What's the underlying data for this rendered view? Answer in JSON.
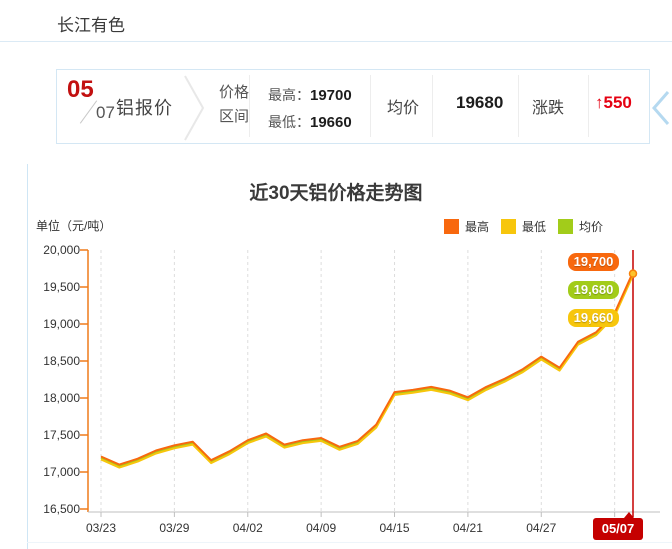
{
  "header": {
    "title": "长江有色"
  },
  "price_bar": {
    "date_top": "05",
    "date_bottom": "07",
    "product": "铝报价",
    "range_label_line1": "价格",
    "range_label_line2": "区间",
    "high_label": "最高：",
    "high_value": "19700",
    "low_label": "最低：",
    "low_value": "19660",
    "avg_label": "均价",
    "avg_value": "19680",
    "change_label": "涨跌",
    "change_arrow": "↑",
    "change_value": "550"
  },
  "icons": {
    "box_chevron": "breadcrumb-arrow",
    "right_chevron": "carousel-prev-arrow"
  },
  "colors": {
    "high": "#f8680e",
    "low": "#f7c60c",
    "avg": "#a2cc1a",
    "highlight_red": "#c50000",
    "change_red": "#e50112",
    "axis_orange": "#ef7b1a",
    "grid_gray": "#dddddd",
    "axis_gray": "#bfbfbf",
    "panel_blue": "#cfe6f5"
  },
  "chart_data": {
    "type": "line",
    "title": "近30天铝价格走势图",
    "unit_label": "单位（元/吨）",
    "ylim": [
      16500,
      20000
    ],
    "grid": "vertical-dashed",
    "legend_position": "top-right",
    "y_ticks": [
      "20,000",
      "19,500",
      "19,000",
      "18,500",
      "18,000",
      "17,500",
      "17,000",
      "16,500"
    ],
    "x_axis_labels": [
      "03/23",
      "03/29",
      "04/02",
      "04/09",
      "04/15",
      "04/21",
      "04/27",
      "05/07"
    ],
    "highlighted_x_label": "05/07",
    "x": [
      "03/23",
      "03/24",
      "03/25",
      "03/26",
      "03/29",
      "03/30",
      "03/31",
      "04/01",
      "04/02",
      "04/06",
      "04/07",
      "04/08",
      "04/09",
      "04/12",
      "04/13",
      "04/14",
      "04/15",
      "04/16",
      "04/19",
      "04/20",
      "04/21",
      "04/22",
      "04/23",
      "04/26",
      "04/27",
      "04/28",
      "04/29",
      "04/30",
      "05/06",
      "05/07"
    ],
    "series": [
      {
        "name": "最高",
        "color": "#f8680e",
        "values": [
          17210,
          17100,
          17180,
          17290,
          17360,
          17410,
          17160,
          17280,
          17430,
          17520,
          17370,
          17430,
          17460,
          17340,
          17420,
          17640,
          18080,
          18110,
          18150,
          18100,
          18010,
          18150,
          18260,
          18390,
          18560,
          18410,
          18760,
          18890,
          19150,
          19700
        ]
      },
      {
        "name": "最低",
        "color": "#f7c60c",
        "values": [
          17170,
          17060,
          17140,
          17250,
          17320,
          17370,
          17120,
          17240,
          17390,
          17480,
          17330,
          17390,
          17420,
          17300,
          17380,
          17600,
          18040,
          18070,
          18110,
          18060,
          17970,
          18110,
          18220,
          18350,
          18520,
          18370,
          18720,
          18850,
          19110,
          19660
        ]
      },
      {
        "name": "均价",
        "color": "#a2cc1a",
        "values": [
          17190,
          17080,
          17160,
          17270,
          17340,
          17390,
          17140,
          17260,
          17410,
          17500,
          17350,
          17410,
          17440,
          17320,
          17400,
          17620,
          18060,
          18090,
          18130,
          18080,
          17990,
          18130,
          18240,
          18370,
          18540,
          18390,
          18740,
          18870,
          19130,
          19680
        ]
      }
    ],
    "end_labels": [
      {
        "text": "19,700",
        "color": "#f8680e"
      },
      {
        "text": "19,680",
        "color": "#a2cc1a"
      },
      {
        "text": "19,660",
        "color": "#f7c60c"
      }
    ]
  }
}
